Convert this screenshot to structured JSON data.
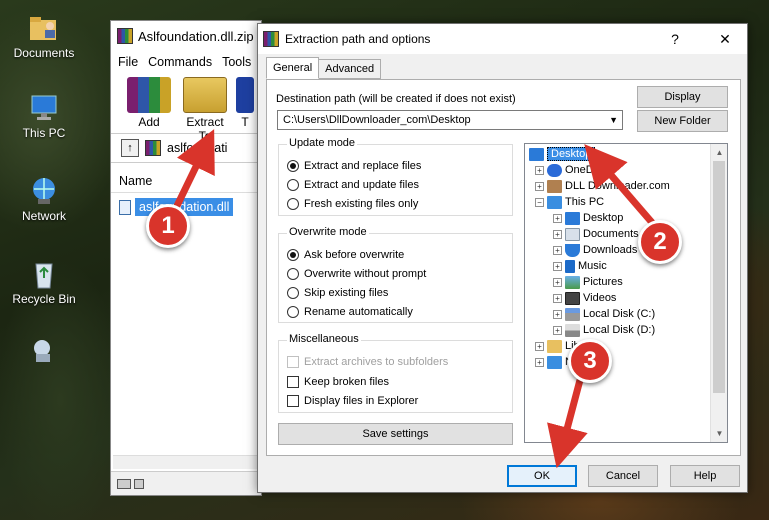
{
  "desktop": {
    "icons": [
      {
        "label": "Documents"
      },
      {
        "label": "This PC"
      },
      {
        "label": "Network"
      },
      {
        "label": "Recycle Bin"
      }
    ]
  },
  "winrar": {
    "title": "Aslfoundation.dll.zip",
    "menu": [
      "File",
      "Commands",
      "Tools"
    ],
    "toolbar": {
      "add": "Add",
      "extract_to": "Extract To",
      "third": "T"
    },
    "address": "aslfoundati",
    "column_name": "Name",
    "file": "aslfoundation.dll"
  },
  "dialog": {
    "title": "Extraction path and options",
    "help_glyph": "?",
    "close_glyph": "✕",
    "tabs": {
      "general": "General",
      "advanced": "Advanced"
    },
    "dest_label": "Destination path (will be created if does not exist)",
    "dest_path": "C:\\Users\\DllDownloader_com\\Desktop",
    "display_button": "Display",
    "new_folder_button": "New Folder",
    "update_mode": {
      "title": "Update mode",
      "options": [
        "Extract and replace files",
        "Extract and update files",
        "Fresh existing files only"
      ],
      "selected": 0
    },
    "overwrite_mode": {
      "title": "Overwrite mode",
      "options": [
        "Ask before overwrite",
        "Overwrite without prompt",
        "Skip existing files",
        "Rename automatically"
      ],
      "selected": 0
    },
    "misc": {
      "title": "Miscellaneous",
      "extract_subfolders": "Extract archives to subfolders",
      "keep_broken": "Keep broken files",
      "display_explorer": "Display files in Explorer"
    },
    "save_settings": "Save settings",
    "tree": {
      "desktop": "Desktop",
      "onedrive": "OneDr",
      "dll": "DLL Downloader.com",
      "thispc": "This PC",
      "pc_desktop": "Desktop",
      "documents": "Documents",
      "downloads": "Downloads",
      "music": "Music",
      "pictures": "Pictures",
      "videos": "Videos",
      "local_c": "Local Disk (C:)",
      "local_d": "Local Disk (D:)",
      "libraries": "Libra",
      "network": "N"
    },
    "ok": "OK",
    "cancel": "Cancel",
    "help": "Help"
  },
  "annotations": {
    "step1": "1",
    "step2": "2",
    "step3": "3"
  },
  "colors": {
    "annotation": "#d9342b",
    "selection": "#3a8ee6",
    "focus": "#0078d7"
  }
}
